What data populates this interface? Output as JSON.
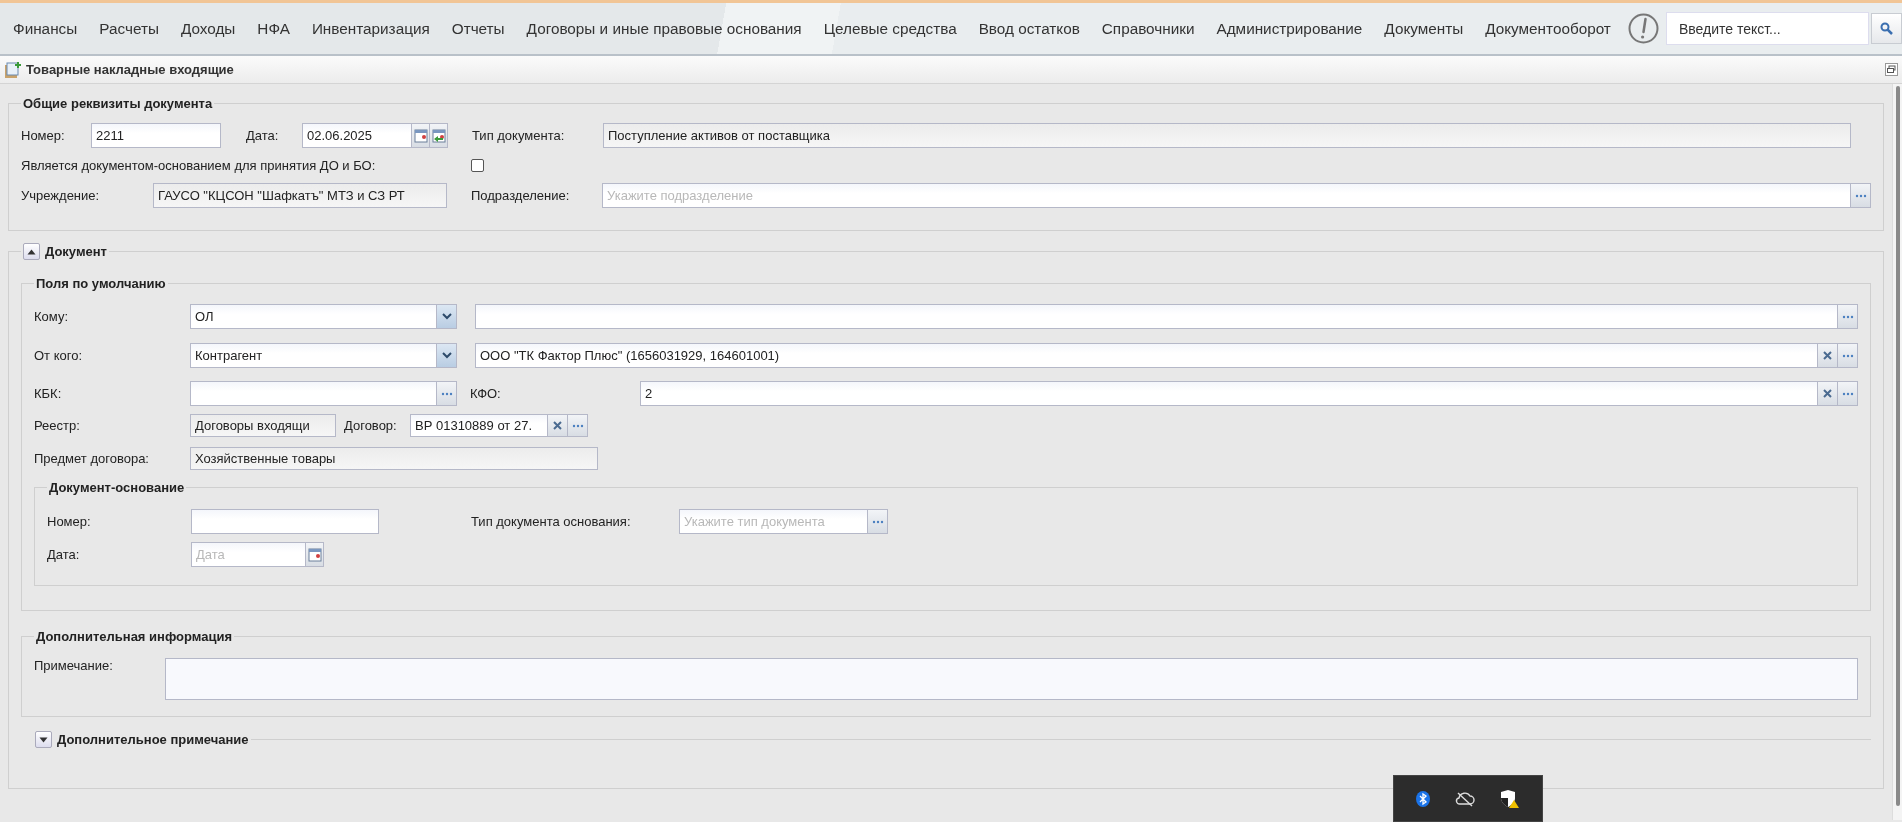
{
  "menu": [
    {
      "label": "Финансы"
    },
    {
      "label": "Расчеты"
    },
    {
      "label": "Доходы"
    },
    {
      "label": "НФА"
    },
    {
      "label": "Инвентаризация"
    },
    {
      "label": "Отчеты"
    },
    {
      "label": "Договоры и иные правовые основания"
    },
    {
      "label": "Целевые средства"
    },
    {
      "label": "Ввод остатков"
    },
    {
      "label": "Справочники"
    },
    {
      "label": "Администрирование"
    },
    {
      "label": "Документы"
    },
    {
      "label": "Документооборот"
    }
  ],
  "search": {
    "placeholder": "Введите текст..."
  },
  "window": {
    "title": "Товарные накладные входящие"
  },
  "general": {
    "title": "Общие реквизиты документа",
    "number": {
      "label": "Номер:",
      "value": "2211",
      "readonly": false
    },
    "date": {
      "label": "Дата:",
      "value": "02.06.2025",
      "readonly": false
    },
    "doc_type": {
      "label": "Тип документа:",
      "value": "Поступление активов от поставщика",
      "readonly": true
    },
    "is_basis": {
      "label": "Является документом-основанием для принятия ДО и БО:",
      "checked": false
    },
    "institution": {
      "label": "Учреждение:",
      "value": "ГАУСО \"КЦСОН \"Шафкатъ\" МТЗ и СЗ РТ",
      "readonly": true
    },
    "subdivision": {
      "label": "Подразделение:",
      "placeholder": "Укажите подразделение",
      "readonly": false
    }
  },
  "document": {
    "title": "Документ",
    "expanded": true,
    "defaults": {
      "title": "Поля по умолчанию",
      "to": {
        "label": "Кому:",
        "value": "ОЛ",
        "readonly": false
      },
      "to_detail": {
        "readonly": false
      },
      "from": {
        "label": "От кого:",
        "value": "Контрагент",
        "readonly": false
      },
      "from_detail": {
        "value": "ООО \"ТК Фактор Плюс\" (1656031929, 164601001)",
        "readonly": false
      },
      "kbk": {
        "label": "КБК:",
        "readonly": false
      },
      "kfo": {
        "label": "КФО:",
        "value": "2",
        "readonly": false
      },
      "registry": {
        "label": "Реестр:",
        "value": "Договоры входящи",
        "readonly": true
      },
      "contract": {
        "label": "Договор:",
        "value": "ВР 01310889 от 27.",
        "readonly": false
      },
      "subject": {
        "label": "Предмет договора:",
        "value": "Хозяйственные товары",
        "readonly": true
      }
    },
    "basis": {
      "title": "Документ-основание",
      "number": {
        "label": "Номер:",
        "readonly": false
      },
      "type": {
        "label": "Тип документа основания:",
        "placeholder": "Укажите тип документа",
        "readonly": false
      },
      "date": {
        "label": "Дата:",
        "placeholder": "Дата",
        "readonly": false
      }
    },
    "extra": {
      "title": "Дополнительная информация",
      "note": {
        "label": "Примечание:",
        "readonly": false
      }
    },
    "extra_note": {
      "title": "Дополнительное примечание",
      "expanded": false
    }
  }
}
